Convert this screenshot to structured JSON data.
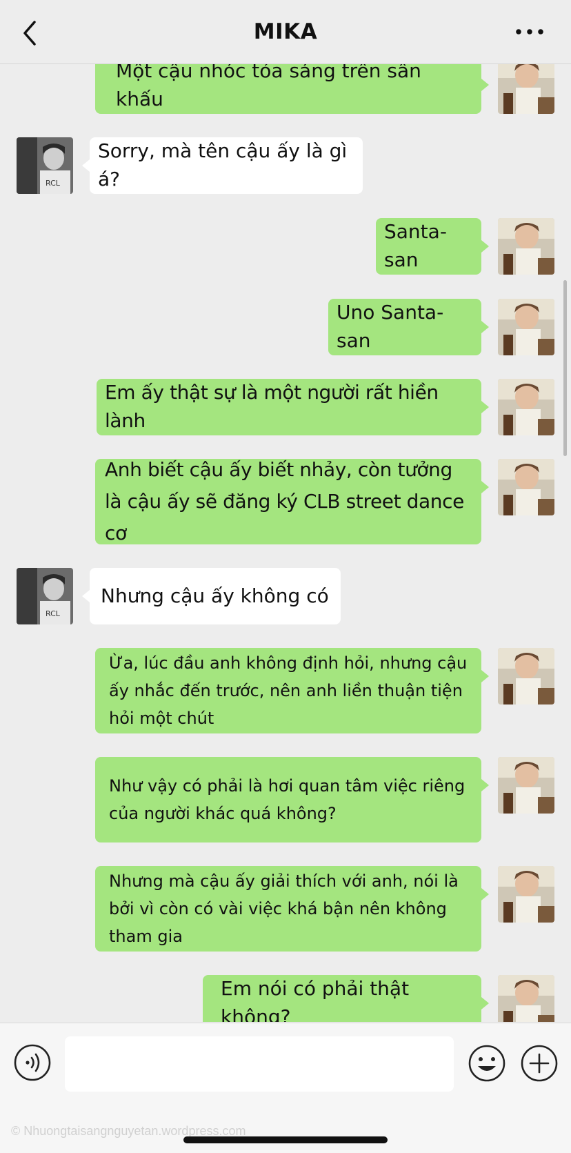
{
  "header": {
    "title": "MIKA",
    "back_icon": "chevron-left-icon",
    "more_icon": "more-dots-icon"
  },
  "colors": {
    "my_bubble": "#a4e57f",
    "their_bubble": "#ffffff",
    "background": "#ededed"
  },
  "messages": [
    {
      "sender": "me",
      "text": "Một cậu nhóc tỏa sáng trên sân khấu"
    },
    {
      "sender": "other",
      "text": "Sorry, mà tên cậu ấy là gì á?"
    },
    {
      "sender": "me",
      "text": "Santa-san"
    },
    {
      "sender": "me",
      "text": "Uno Santa-san"
    },
    {
      "sender": "me",
      "text": "Em ấy thật sự là một người rất hiền lành"
    },
    {
      "sender": "me",
      "text": "Anh biết cậu ấy biết nhảy, còn tưởng là cậu ấy sẽ đăng ký CLB street dance cơ"
    },
    {
      "sender": "other",
      "text": "Nhưng cậu ấy không có"
    },
    {
      "sender": "me",
      "text": "Ừa, lúc đầu anh không định hỏi, nhưng cậu ấy nhắc đến trước, nên anh liền thuận tiện hỏi một chút"
    },
    {
      "sender": "me",
      "text": "Như vậy có phải là hơi quan tâm việc riêng của người khác quá không?"
    },
    {
      "sender": "me",
      "text": "Nhưng mà cậu ấy giải thích với anh, nói là bởi vì còn có vài việc khá bận nên không tham gia"
    },
    {
      "sender": "me",
      "text": "Em nói có phải thật không?"
    }
  ],
  "input": {
    "placeholder": "",
    "value": "",
    "voice_icon": "voice-icon",
    "emoji_icon": "emoji-icon",
    "plus_icon": "plus-circle-icon"
  },
  "watermark": "© Nhuongtaisangnguyetan.wordpress.com"
}
